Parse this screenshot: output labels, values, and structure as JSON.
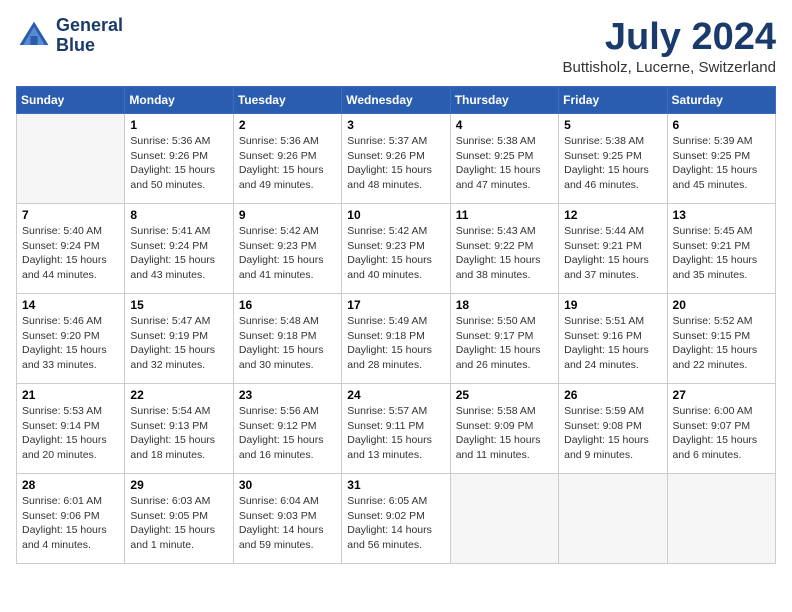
{
  "header": {
    "logo_line1": "General",
    "logo_line2": "Blue",
    "month_year": "July 2024",
    "location": "Buttisholz, Lucerne, Switzerland"
  },
  "days_of_week": [
    "Sunday",
    "Monday",
    "Tuesday",
    "Wednesday",
    "Thursday",
    "Friday",
    "Saturday"
  ],
  "weeks": [
    [
      {
        "day": "",
        "info": ""
      },
      {
        "day": "1",
        "info": "Sunrise: 5:36 AM\nSunset: 9:26 PM\nDaylight: 15 hours\nand 50 minutes."
      },
      {
        "day": "2",
        "info": "Sunrise: 5:36 AM\nSunset: 9:26 PM\nDaylight: 15 hours\nand 49 minutes."
      },
      {
        "day": "3",
        "info": "Sunrise: 5:37 AM\nSunset: 9:26 PM\nDaylight: 15 hours\nand 48 minutes."
      },
      {
        "day": "4",
        "info": "Sunrise: 5:38 AM\nSunset: 9:25 PM\nDaylight: 15 hours\nand 47 minutes."
      },
      {
        "day": "5",
        "info": "Sunrise: 5:38 AM\nSunset: 9:25 PM\nDaylight: 15 hours\nand 46 minutes."
      },
      {
        "day": "6",
        "info": "Sunrise: 5:39 AM\nSunset: 9:25 PM\nDaylight: 15 hours\nand 45 minutes."
      }
    ],
    [
      {
        "day": "7",
        "info": "Sunrise: 5:40 AM\nSunset: 9:24 PM\nDaylight: 15 hours\nand 44 minutes."
      },
      {
        "day": "8",
        "info": "Sunrise: 5:41 AM\nSunset: 9:24 PM\nDaylight: 15 hours\nand 43 minutes."
      },
      {
        "day": "9",
        "info": "Sunrise: 5:42 AM\nSunset: 9:23 PM\nDaylight: 15 hours\nand 41 minutes."
      },
      {
        "day": "10",
        "info": "Sunrise: 5:42 AM\nSunset: 9:23 PM\nDaylight: 15 hours\nand 40 minutes."
      },
      {
        "day": "11",
        "info": "Sunrise: 5:43 AM\nSunset: 9:22 PM\nDaylight: 15 hours\nand 38 minutes."
      },
      {
        "day": "12",
        "info": "Sunrise: 5:44 AM\nSunset: 9:21 PM\nDaylight: 15 hours\nand 37 minutes."
      },
      {
        "day": "13",
        "info": "Sunrise: 5:45 AM\nSunset: 9:21 PM\nDaylight: 15 hours\nand 35 minutes."
      }
    ],
    [
      {
        "day": "14",
        "info": "Sunrise: 5:46 AM\nSunset: 9:20 PM\nDaylight: 15 hours\nand 33 minutes."
      },
      {
        "day": "15",
        "info": "Sunrise: 5:47 AM\nSunset: 9:19 PM\nDaylight: 15 hours\nand 32 minutes."
      },
      {
        "day": "16",
        "info": "Sunrise: 5:48 AM\nSunset: 9:18 PM\nDaylight: 15 hours\nand 30 minutes."
      },
      {
        "day": "17",
        "info": "Sunrise: 5:49 AM\nSunset: 9:18 PM\nDaylight: 15 hours\nand 28 minutes."
      },
      {
        "day": "18",
        "info": "Sunrise: 5:50 AM\nSunset: 9:17 PM\nDaylight: 15 hours\nand 26 minutes."
      },
      {
        "day": "19",
        "info": "Sunrise: 5:51 AM\nSunset: 9:16 PM\nDaylight: 15 hours\nand 24 minutes."
      },
      {
        "day": "20",
        "info": "Sunrise: 5:52 AM\nSunset: 9:15 PM\nDaylight: 15 hours\nand 22 minutes."
      }
    ],
    [
      {
        "day": "21",
        "info": "Sunrise: 5:53 AM\nSunset: 9:14 PM\nDaylight: 15 hours\nand 20 minutes."
      },
      {
        "day": "22",
        "info": "Sunrise: 5:54 AM\nSunset: 9:13 PM\nDaylight: 15 hours\nand 18 minutes."
      },
      {
        "day": "23",
        "info": "Sunrise: 5:56 AM\nSunset: 9:12 PM\nDaylight: 15 hours\nand 16 minutes."
      },
      {
        "day": "24",
        "info": "Sunrise: 5:57 AM\nSunset: 9:11 PM\nDaylight: 15 hours\nand 13 minutes."
      },
      {
        "day": "25",
        "info": "Sunrise: 5:58 AM\nSunset: 9:09 PM\nDaylight: 15 hours\nand 11 minutes."
      },
      {
        "day": "26",
        "info": "Sunrise: 5:59 AM\nSunset: 9:08 PM\nDaylight: 15 hours\nand 9 minutes."
      },
      {
        "day": "27",
        "info": "Sunrise: 6:00 AM\nSunset: 9:07 PM\nDaylight: 15 hours\nand 6 minutes."
      }
    ],
    [
      {
        "day": "28",
        "info": "Sunrise: 6:01 AM\nSunset: 9:06 PM\nDaylight: 15 hours\nand 4 minutes."
      },
      {
        "day": "29",
        "info": "Sunrise: 6:03 AM\nSunset: 9:05 PM\nDaylight: 15 hours\nand 1 minute."
      },
      {
        "day": "30",
        "info": "Sunrise: 6:04 AM\nSunset: 9:03 PM\nDaylight: 14 hours\nand 59 minutes."
      },
      {
        "day": "31",
        "info": "Sunrise: 6:05 AM\nSunset: 9:02 PM\nDaylight: 14 hours\nand 56 minutes."
      },
      {
        "day": "",
        "info": ""
      },
      {
        "day": "",
        "info": ""
      },
      {
        "day": "",
        "info": ""
      }
    ]
  ]
}
